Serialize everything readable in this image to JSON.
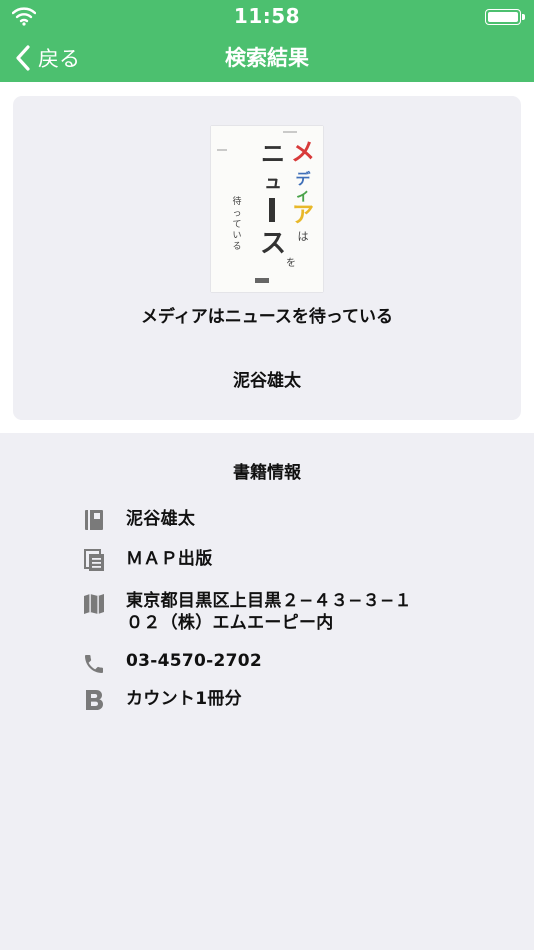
{
  "status_bar": {
    "time": "11:58"
  },
  "navbar": {
    "back_label": "戻る",
    "title": "検索結果"
  },
  "book": {
    "title": "メディアはニュースを待っている",
    "author": "泥谷雄太",
    "cover": {
      "title_line1": "メディア",
      "title_particle1": "は",
      "title_line2": "ニュース",
      "title_particle2": "を",
      "subtitle": "待っている"
    }
  },
  "info": {
    "section_title": "書籍情報",
    "author": "泥谷雄太",
    "publisher": "ＭＡＰ出版",
    "address_line1": "東京都目黒区上目黒２−４３−３−１",
    "address_line2": "０２（株）エムエーピー内",
    "phone": "03-4570-2702",
    "count": "カウント1冊分"
  },
  "icons": {
    "wifi": "wifi-icon",
    "battery": "battery-icon",
    "back": "chevron-left-icon",
    "author": "book-icon",
    "publisher": "document-icon",
    "address": "map-icon",
    "phone": "phone-icon",
    "count": "b-letter-icon"
  },
  "colors": {
    "nav_green": "#4cc06f",
    "page_bg": "#efeff4",
    "icon_gray": "#7a7a7a",
    "cover_red": "#d83a3a",
    "cover_blue": "#3f6fb8",
    "cover_green": "#4aa24a",
    "cover_yellow": "#e8b82a"
  }
}
